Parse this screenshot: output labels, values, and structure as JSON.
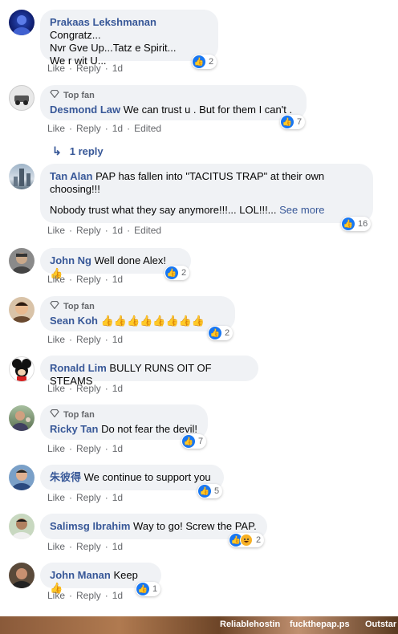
{
  "actions": {
    "like": "Like",
    "reply": "Reply",
    "edited": "Edited"
  },
  "comments": [
    {
      "author": "Prakaas Lekshmanan",
      "text1": "Congratz...",
      "text2": "Nvr Gve Up...Tatz e Spirit...",
      "text3": "We r wit U...",
      "time": "1d",
      "reactions": "2"
    },
    {
      "top_fan": "Top fan",
      "author": "Desmond Law",
      "text": "We can trust u . But for them I can't .",
      "time": "1d",
      "reactions": "7"
    },
    {
      "author": "Tan Alan",
      "text1": "PAP has fallen into \"TACITUS TRAP\" at their own choosing!!!",
      "text2": "Nobody trust what they say anymore!!!... LOL!!!...",
      "see_more": "See more",
      "time": "1d",
      "reactions": "16"
    },
    {
      "author": "John Ng",
      "text": "Well done Alex! 👍",
      "time": "1d",
      "reactions": "2"
    },
    {
      "top_fan": "Top fan",
      "author": "Sean Koh",
      "text": "👍👍👍👍👍👍👍👍",
      "time": "1d",
      "reactions": "2"
    },
    {
      "author": "Ronald Lim",
      "text": "BULLY RUNS OIT OF STEAMS",
      "time": "1d"
    },
    {
      "top_fan": "Top fan",
      "author": "Ricky Tan",
      "text": "Do not fear the devil!",
      "time": "1d",
      "reactions": "7"
    },
    {
      "author": "朱彼得",
      "text": "We continue to support you",
      "time": "1d",
      "reactions": "5"
    },
    {
      "author": "Salimsg Ibrahim",
      "text": "Way to go! Screw the PAP.",
      "time": "1d",
      "reactions": "2"
    },
    {
      "author": "John Manan",
      "text": "Keep 👍",
      "time": "1d",
      "reactions": "1"
    }
  ],
  "reply_link": "1 reply",
  "bottom_bar": {
    "item1": "Reliablehostin",
    "item2": "fuckthepap.ps",
    "item3": "Outstar"
  },
  "colors": {
    "link": "#385898",
    "bubble": "#f0f2f5",
    "like": "#1877f2"
  }
}
